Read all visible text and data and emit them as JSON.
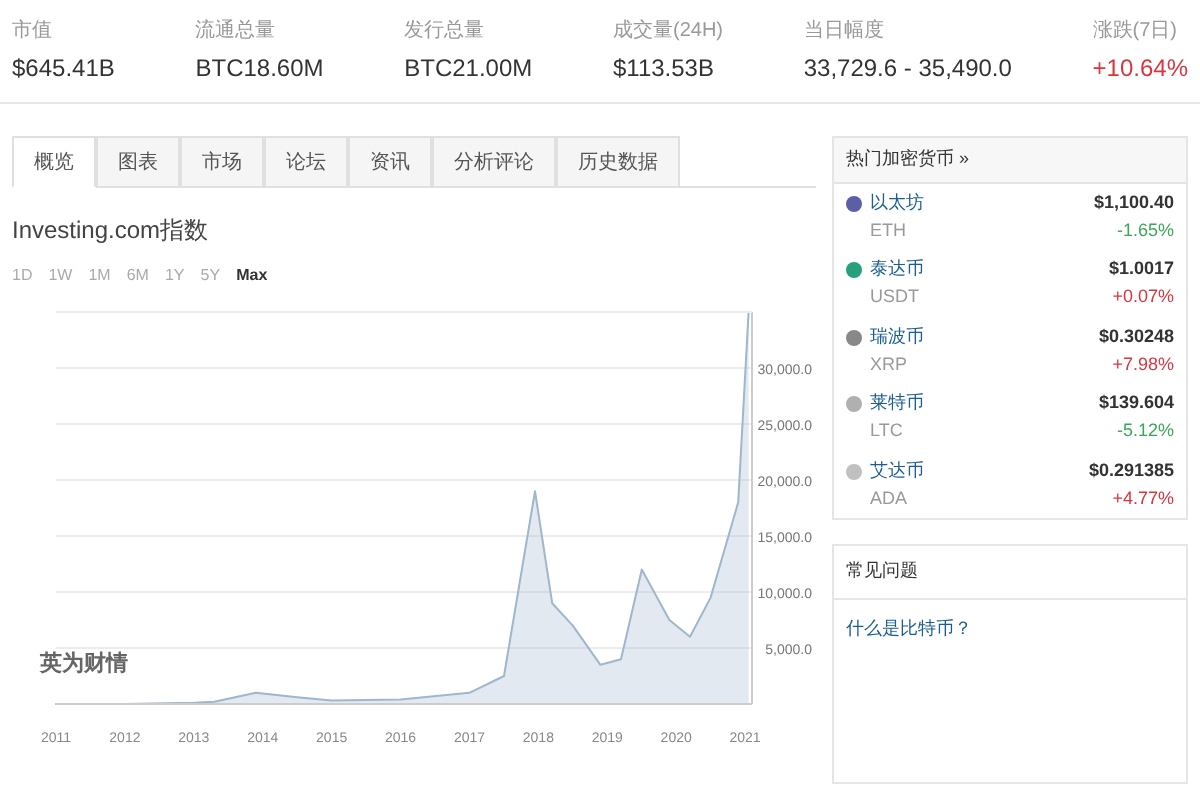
{
  "stats": [
    {
      "label": "市值",
      "value": "$645.41B",
      "positive": false
    },
    {
      "label": "流通总量",
      "value": "BTC18.60M",
      "positive": false
    },
    {
      "label": "发行总量",
      "value": "BTC21.00M",
      "positive": false
    },
    {
      "label": "成交量(24H)",
      "value": "$113.53B",
      "positive": false
    },
    {
      "label": "当日幅度",
      "value": "33,729.6 - 35,490.0",
      "positive": false
    },
    {
      "label": "涨跌(7日)",
      "value": "+10.64%",
      "positive": true
    }
  ],
  "tabs": [
    {
      "label": "概览",
      "selected": true
    },
    {
      "label": "图表",
      "selected": false
    },
    {
      "label": "市场",
      "selected": false
    },
    {
      "label": "论坛",
      "selected": false
    },
    {
      "label": "资讯",
      "selected": false
    },
    {
      "label": "分析评论",
      "selected": false
    },
    {
      "label": "历史数据",
      "selected": false
    }
  ],
  "chart_title": "Investing.com指数",
  "ranges": [
    {
      "label": "1D",
      "selected": false
    },
    {
      "label": "1W",
      "selected": false
    },
    {
      "label": "1M",
      "selected": false
    },
    {
      "label": "6M",
      "selected": false
    },
    {
      "label": "1Y",
      "selected": false
    },
    {
      "label": "5Y",
      "selected": false
    },
    {
      "label": "Max",
      "selected": true
    }
  ],
  "chart_logo": "英为财情",
  "chart_data": {
    "type": "area",
    "x": [
      2011,
      2012,
      2013,
      2013.3,
      2013.9,
      2014.5,
      2015,
      2016,
      2017,
      2017.5,
      2017.95,
      2018.2,
      2018.5,
      2018.9,
      2019.2,
      2019.5,
      2019.9,
      2020.2,
      2020.5,
      2020.9,
      2021.05
    ],
    "series": [
      {
        "color": "#9fb7cc",
        "values": [
          0,
          0,
          100,
          200,
          1000,
          600,
          300,
          400,
          1000,
          2500,
          19000,
          9000,
          7000,
          3500,
          4000,
          12000,
          7500,
          6000,
          9500,
          18000,
          35000
        ]
      }
    ],
    "xlim": [
      2011,
      2021.1
    ],
    "ylim": [
      0,
      35000
    ],
    "grid": true,
    "xticks": [
      2011,
      2012,
      2013,
      2014,
      2015,
      2016,
      2017,
      2018,
      2019,
      2020,
      2021
    ],
    "yticks": [
      {
        "value": 5000,
        "label": "5,000.0"
      },
      {
        "value": 10000,
        "label": "10,000.0"
      },
      {
        "value": 15000,
        "label": "15,000.0"
      },
      {
        "value": 20000,
        "label": "20,000.0"
      },
      {
        "value": 25000,
        "label": "25,000.0"
      },
      {
        "value": 30000,
        "label": "30,000.0"
      }
    ]
  },
  "popular": {
    "title": "热门加密货币 »",
    "items": [
      {
        "name": "以太坊",
        "symbol": "ETH",
        "price": "$1,100.40",
        "change": "-1.65%",
        "color": "#5b5fa8"
      },
      {
        "name": "泰达币",
        "symbol": "USDT",
        "price": "$1.0017",
        "change": "+0.07%",
        "color": "#26a17b"
      },
      {
        "name": "瑞波币",
        "symbol": "XRP",
        "price": "$0.30248",
        "change": "+7.98%",
        "color": "#888888"
      },
      {
        "name": "莱特币",
        "symbol": "LTC",
        "price": "$139.604",
        "change": "-5.12%",
        "color": "#b0b0b0"
      },
      {
        "name": "艾达币",
        "symbol": "ADA",
        "price": "$0.291385",
        "change": "+4.77%",
        "color": "#c0c0c0"
      }
    ]
  },
  "faq": {
    "title": "常见问题",
    "question": "什么是比特币？"
  }
}
